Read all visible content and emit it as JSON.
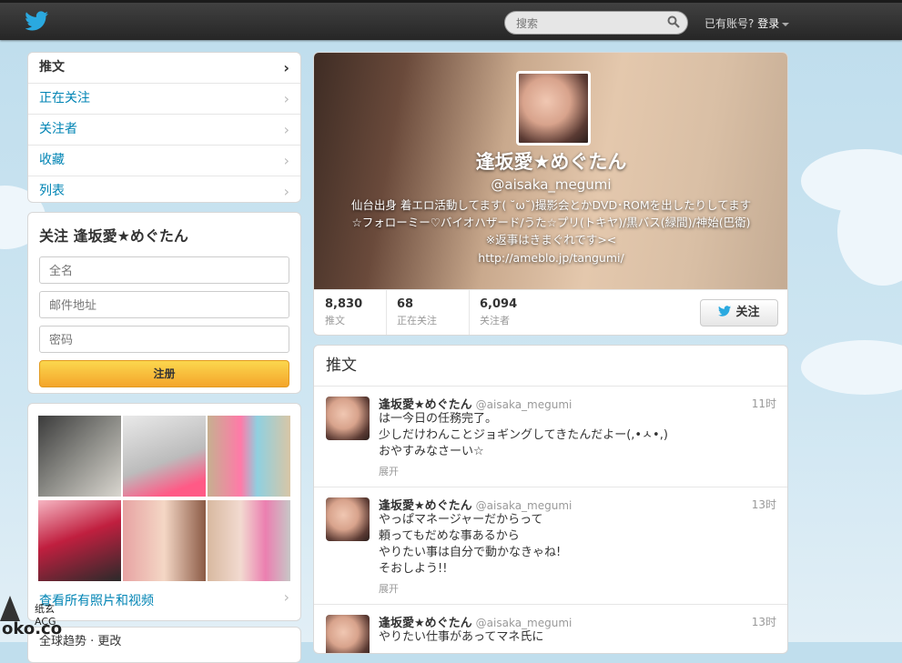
{
  "topbar": {
    "search_placeholder": "搜索",
    "login_prompt": "已有账号?",
    "login_label": "登录"
  },
  "nav": {
    "items": [
      {
        "label": "推文"
      },
      {
        "label": "正在关注"
      },
      {
        "label": "关注者"
      },
      {
        "label": "收藏"
      },
      {
        "label": "列表"
      }
    ]
  },
  "follow_box": {
    "title": "关注 逢坂愛★めぐたん",
    "fullname_placeholder": "全名",
    "email_placeholder": "邮件地址",
    "password_placeholder": "密码",
    "signup_label": "注册"
  },
  "media": {
    "view_all_label": "查看所有照片和视频"
  },
  "profile": {
    "name": "逢坂愛★めぐたん",
    "handle": "@aisaka_megumi",
    "bio": "仙台出身 着エロ活動してます( ˘ω˘)撮影会とかDVD･ROMを出したりしてます☆フォローミー♡バイオハザード/うた☆プリ(トキヤ)/黒バス(緑間)/神始(巴衛) ※返事はきまぐれです>< ",
    "url": "http://ameblo.jp/tangumi/",
    "stats": [
      {
        "value": "8,830",
        "label": "推文"
      },
      {
        "value": "68",
        "label": "正在关注"
      },
      {
        "value": "6,094",
        "label": "关注者"
      }
    ],
    "follow_label": "关注"
  },
  "tweets_header": "推文",
  "tweets": [
    {
      "name": "逢坂愛★めぐたん",
      "handle": "@aisaka_megumi",
      "time": "11时",
      "text": "は一今日の任務完了。\n少しだけわんことジョギングしてきたんだよー(,•ㅅ•,)\nおやすみなさーい☆",
      "expand": "展开"
    },
    {
      "name": "逢坂愛★めぐたん",
      "handle": "@aisaka_megumi",
      "time": "13时",
      "text": "やっぱマネージャーだからって\n頼ってもだめな事あるから\nやりたい事は自分で動かなきゃね!\nそおしよう!!",
      "expand": "展开"
    },
    {
      "name": "逢坂愛★めぐたん",
      "handle": "@aisaka_megumi",
      "time": "13时",
      "text": "やりたい仕事があってマネ氏に",
      "expand": ""
    }
  ],
  "trends_partial": "全球趋势 · 更改",
  "watermark": {
    "line1": "纸玄ACG",
    "line2": "oko.co"
  },
  "colors": {
    "link": "#0084b4",
    "topbar": "#2b2b2b",
    "background": "#c0deed",
    "signup": "#f4a52b"
  }
}
